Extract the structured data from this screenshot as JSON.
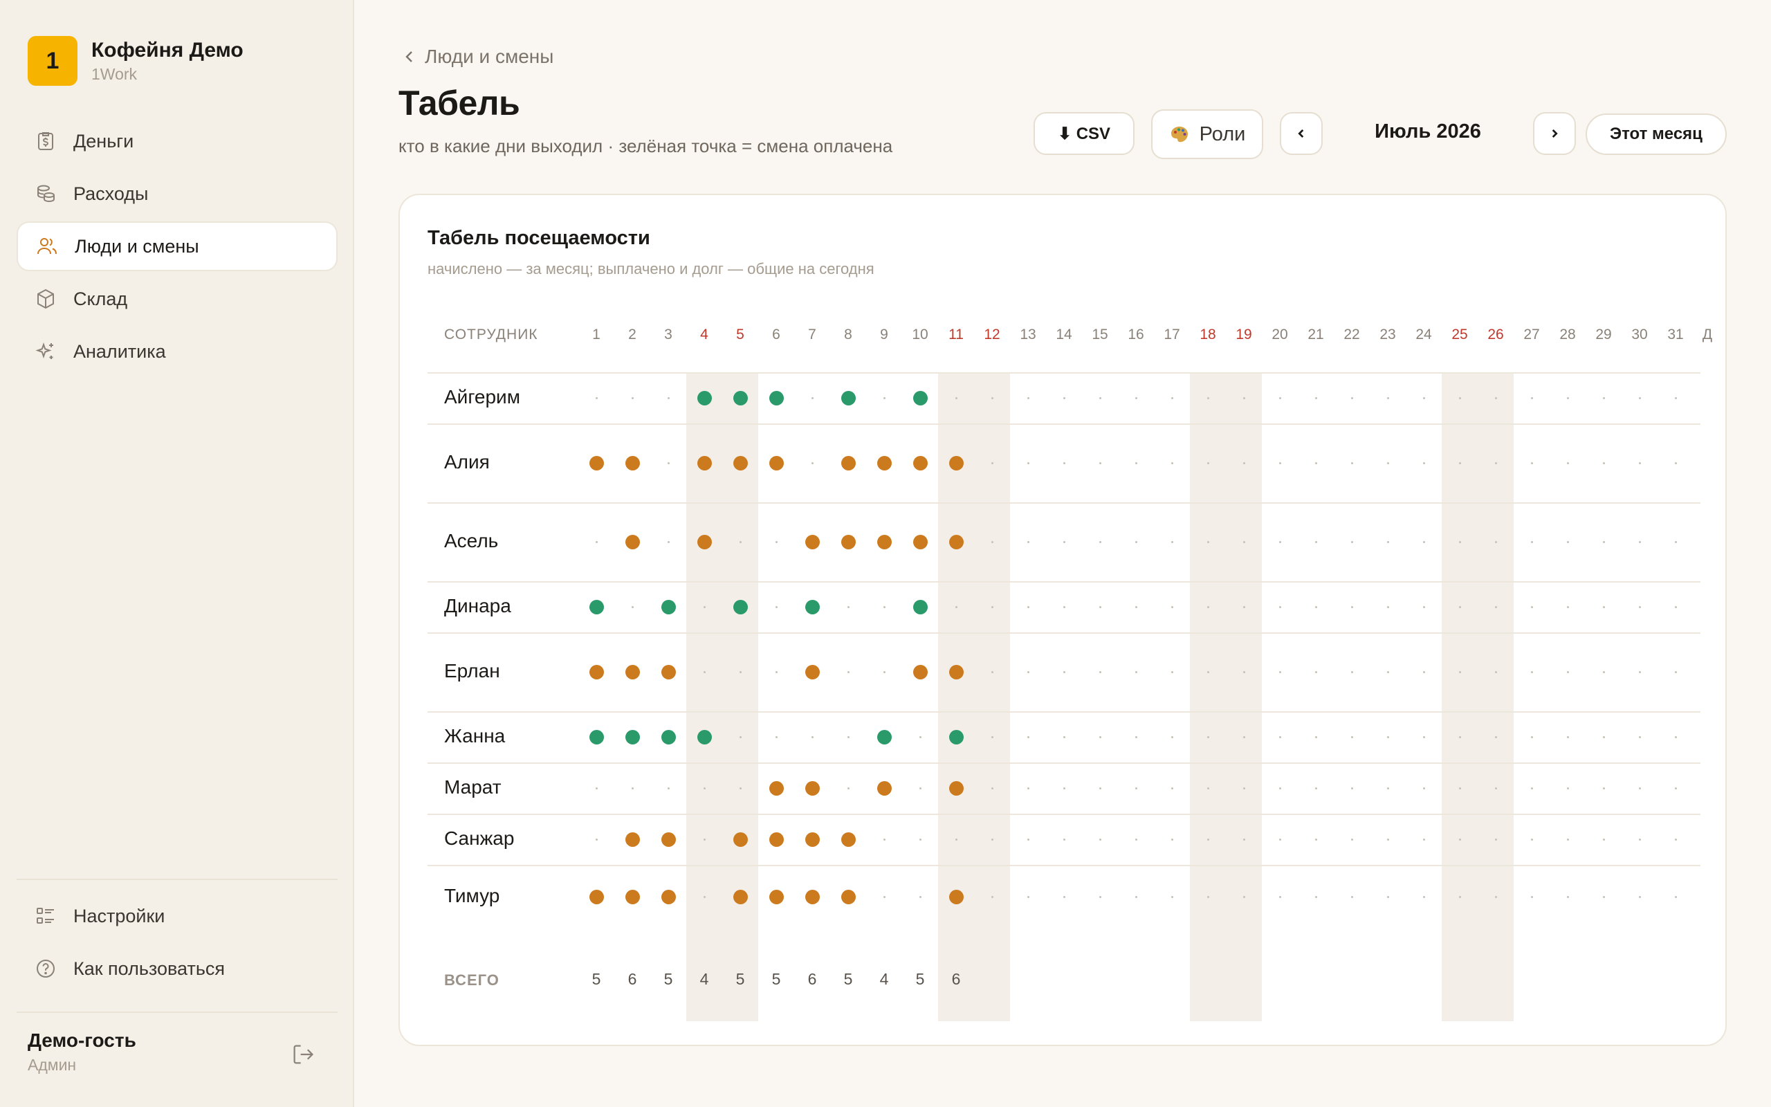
{
  "brand": {
    "badge": "1",
    "name": "Кофейня Демо",
    "sub": "1Work"
  },
  "nav": [
    {
      "label": "Деньги",
      "icon": "money-icon",
      "active": false
    },
    {
      "label": "Расходы",
      "icon": "coins-icon",
      "active": false
    },
    {
      "label": "Люди и смены",
      "icon": "people-icon",
      "active": true
    },
    {
      "label": "Склад",
      "icon": "box-icon",
      "active": false
    },
    {
      "label": "Аналитика",
      "icon": "sparkle-icon",
      "active": false
    }
  ],
  "bottom_nav": [
    {
      "label": "Настройки",
      "icon": "settings-list-icon"
    },
    {
      "label": "Как пользоваться",
      "icon": "help-icon"
    }
  ],
  "user": {
    "name": "Демо-гость",
    "role": "Админ"
  },
  "header": {
    "breadcrumb": "Люди и смены",
    "title": "Табель",
    "subtitle": "кто в какие дни выходил · зелёная точка = смена оплачена",
    "csv_label": "⬇ CSV",
    "roles_label": "Роли",
    "month": "Июль 2026",
    "this_month": "Этот месяц"
  },
  "card": {
    "title": "Табель посещаемости",
    "subtitle": "начислено — за месяц; выплачено и долг — общие на сегодня",
    "employee_header": "СОТРУДНИК",
    "total_label": "ВСЕГО",
    "overflow_header": "Д"
  },
  "days": [
    1,
    2,
    3,
    4,
    5,
    6,
    7,
    8,
    9,
    10,
    11,
    12,
    13,
    14,
    15,
    16,
    17,
    18,
    19,
    20,
    21,
    22,
    23,
    24,
    25,
    26,
    27,
    28,
    29,
    30,
    31
  ],
  "weekend_days": [
    4,
    5,
    11,
    12,
    18,
    19,
    25,
    26
  ],
  "colors": {
    "paid": "#2a9a6a",
    "worked": "#cc7a1e",
    "weekend": "#c0392b",
    "brand": "#f6b400"
  },
  "employees": [
    {
      "name": "Айгерим",
      "days": {
        "4": "p",
        "5": "p",
        "6": "p",
        "8": "p",
        "10": "p"
      }
    },
    {
      "name": "Алия",
      "days": {
        "1": "w",
        "2": "w",
        "4": "w",
        "5": "w",
        "6": "w",
        "8": "w",
        "9": "w",
        "10": "w",
        "11": "w"
      }
    },
    {
      "name": "Асель",
      "days": {
        "2": "w",
        "4": "w",
        "7": "w",
        "8": "w",
        "9": "w",
        "10": "w",
        "11": "w"
      }
    },
    {
      "name": "Динара",
      "days": {
        "1": "p",
        "3": "p",
        "5": "p",
        "7": "p",
        "10": "p"
      }
    },
    {
      "name": "Ерлан",
      "days": {
        "1": "w",
        "2": "w",
        "3": "w",
        "7": "w",
        "10": "w",
        "11": "w"
      }
    },
    {
      "name": "Жанна",
      "days": {
        "1": "p",
        "2": "p",
        "3": "p",
        "4": "p",
        "9": "p",
        "11": "p"
      }
    },
    {
      "name": "Марат",
      "days": {
        "6": "w",
        "7": "w",
        "9": "w",
        "11": "w"
      }
    },
    {
      "name": "Санжар",
      "days": {
        "2": "w",
        "3": "w",
        "5": "w",
        "6": "w",
        "7": "w",
        "8": "w"
      }
    },
    {
      "name": "Тимур",
      "days": {
        "1": "w",
        "2": "w",
        "3": "w",
        "5": "w",
        "6": "w",
        "7": "w",
        "8": "w",
        "11": "w"
      }
    }
  ],
  "totals": [
    5,
    6,
    5,
    4,
    5,
    5,
    6,
    5,
    4,
    5,
    6
  ]
}
